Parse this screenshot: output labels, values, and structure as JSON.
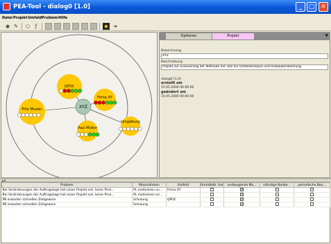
{
  "window": {
    "title": "PEA-Tool - dialog0 [1.0]",
    "min_label": "_",
    "max_label": "▢",
    "close_label": "✕"
  },
  "menu": [
    "Datei",
    "Projekt",
    "Umfeld",
    "Problem",
    "Hilfe"
  ],
  "toolbar_icons": [
    "play-circle-icon",
    "pin-icon",
    "circle-icon",
    "script-icon",
    "grid-icon",
    "grid-icon",
    "grid-icon",
    "grid-icon",
    "grid-icon",
    "grid-icon",
    "flag-icon",
    "export-icon"
  ],
  "diagram": {
    "center": "XYZ",
    "nodes": [
      {
        "name": "QPOC"
      },
      {
        "name": "Firma XY"
      },
      {
        "name": "Fritz Muster"
      },
      {
        "name": "Umgebung"
      },
      {
        "name": "Paul Müller"
      }
    ]
  },
  "tabs": {
    "options": "Optionen",
    "project": "Projekt",
    "arrow": "▼"
  },
  "project": {
    "name_label": "Bezeichnung",
    "name_value": "XYZ",
    "desc_label": "Beschreibung",
    "desc_value": "Projekt zur Evaluierung der Methode mit Tool zur Umfeldanalyse und Risikoüberwachung",
    "version": "dialog0 [1.0]",
    "created_label": "erstellt am",
    "created_value": "15.05.2000 00:00:00",
    "changed_label": "geändert am",
    "changed_value": "15.05.2000 00:00:00"
  },
  "table": {
    "headers": [
      "Problem",
      "Massnahmen",
      "Umfeld",
      "Unmittelb. Handl.",
      "vorbeugende Ma...",
      "ständige Beoba...",
      "periodische Beo..."
    ],
    "rows": [
      [
        "Bei Veränderungen der Auftragslage hat unser Projekt evt. keine Prior...",
        "PL motivieren un...",
        "Firma XY"
      ],
      [
        "Bei Veränderungen der Auftragslage hat unser Projekt evt. keine Prior...",
        "PL motivieren un...",
        ""
      ],
      [
        "PB erwarten schnellen Zeitgewinn",
        "Schulung",
        "QPOC"
      ],
      [
        "PB erwarten schnellen Zeitgewinn",
        "Schulung",
        ""
      ]
    ],
    "checks": [
      [
        false,
        true,
        false,
        false
      ],
      [
        false,
        true,
        false,
        false
      ],
      [
        false,
        true,
        false,
        false
      ],
      [
        false,
        true,
        false,
        false
      ]
    ],
    "check_mark": "✔"
  },
  "colors": {
    "node_fill": "#ffc800",
    "center_fill": "#a9c9b4",
    "red": "#e00000",
    "green": "#22cc22",
    "title_blue": "#0a57d8"
  }
}
